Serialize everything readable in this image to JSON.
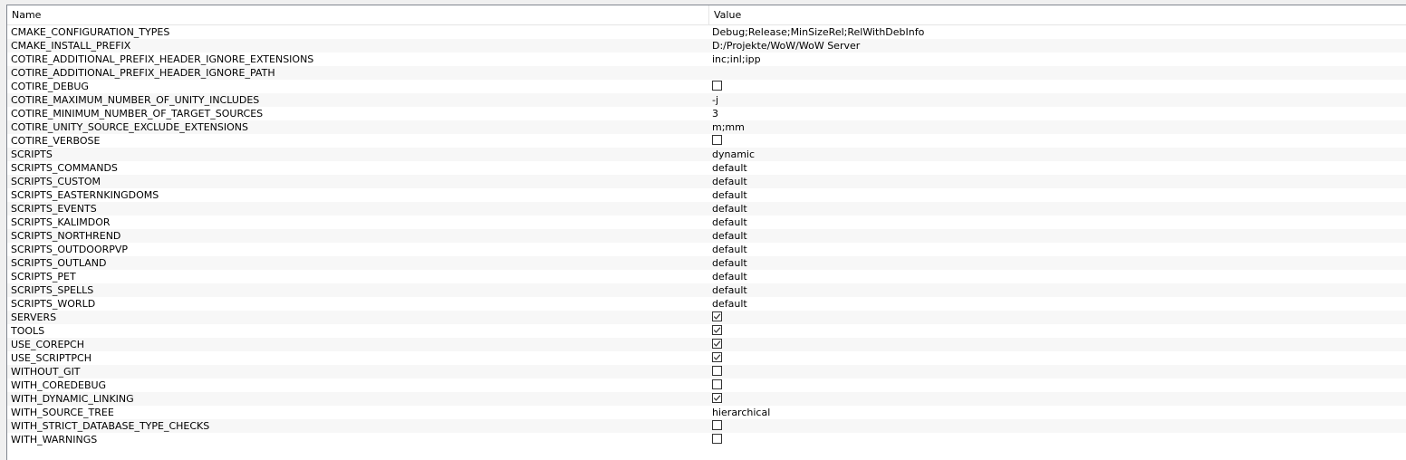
{
  "header": {
    "name_label": "Name",
    "value_label": "Value"
  },
  "rows": [
    {
      "name": "CMAKE_CONFIGURATION_TYPES",
      "type": "text",
      "value": "Debug;Release;MinSizeRel;RelWithDebInfo"
    },
    {
      "name": "CMAKE_INSTALL_PREFIX",
      "type": "text",
      "value": "D:/Projekte/WoW/WoW Server"
    },
    {
      "name": "COTIRE_ADDITIONAL_PREFIX_HEADER_IGNORE_EXTENSIONS",
      "type": "text",
      "value": "inc;inl;ipp"
    },
    {
      "name": "COTIRE_ADDITIONAL_PREFIX_HEADER_IGNORE_PATH",
      "type": "text",
      "value": ""
    },
    {
      "name": "COTIRE_DEBUG",
      "type": "bool",
      "checked": false
    },
    {
      "name": "COTIRE_MAXIMUM_NUMBER_OF_UNITY_INCLUDES",
      "type": "text",
      "value": "-j"
    },
    {
      "name": "COTIRE_MINIMUM_NUMBER_OF_TARGET_SOURCES",
      "type": "text",
      "value": "3"
    },
    {
      "name": "COTIRE_UNITY_SOURCE_EXCLUDE_EXTENSIONS",
      "type": "text",
      "value": "m;mm"
    },
    {
      "name": "COTIRE_VERBOSE",
      "type": "bool",
      "checked": false
    },
    {
      "name": "SCRIPTS",
      "type": "text",
      "value": "dynamic"
    },
    {
      "name": "SCRIPTS_COMMANDS",
      "type": "text",
      "value": "default"
    },
    {
      "name": "SCRIPTS_CUSTOM",
      "type": "text",
      "value": "default"
    },
    {
      "name": "SCRIPTS_EASTERNKINGDOMS",
      "type": "text",
      "value": "default"
    },
    {
      "name": "SCRIPTS_EVENTS",
      "type": "text",
      "value": "default"
    },
    {
      "name": "SCRIPTS_KALIMDOR",
      "type": "text",
      "value": "default"
    },
    {
      "name": "SCRIPTS_NORTHREND",
      "type": "text",
      "value": "default"
    },
    {
      "name": "SCRIPTS_OUTDOORPVP",
      "type": "text",
      "value": "default"
    },
    {
      "name": "SCRIPTS_OUTLAND",
      "type": "text",
      "value": "default"
    },
    {
      "name": "SCRIPTS_PET",
      "type": "text",
      "value": "default"
    },
    {
      "name": "SCRIPTS_SPELLS",
      "type": "text",
      "value": "default"
    },
    {
      "name": "SCRIPTS_WORLD",
      "type": "text",
      "value": "default"
    },
    {
      "name": "SERVERS",
      "type": "bool",
      "checked": true
    },
    {
      "name": "TOOLS",
      "type": "bool",
      "checked": true
    },
    {
      "name": "USE_COREPCH",
      "type": "bool",
      "checked": true
    },
    {
      "name": "USE_SCRIPTPCH",
      "type": "bool",
      "checked": true
    },
    {
      "name": "WITHOUT_GIT",
      "type": "bool",
      "checked": false
    },
    {
      "name": "WITH_COREDEBUG",
      "type": "bool",
      "checked": false
    },
    {
      "name": "WITH_DYNAMIC_LINKING",
      "type": "bool",
      "checked": true
    },
    {
      "name": "WITH_SOURCE_TREE",
      "type": "text",
      "value": "hierarchical"
    },
    {
      "name": "WITH_STRICT_DATABASE_TYPE_CHECKS",
      "type": "bool",
      "checked": false
    },
    {
      "name": "WITH_WARNINGS",
      "type": "bool",
      "checked": false
    }
  ],
  "colors": {
    "checkmark": "#333333",
    "border": "#828790"
  }
}
